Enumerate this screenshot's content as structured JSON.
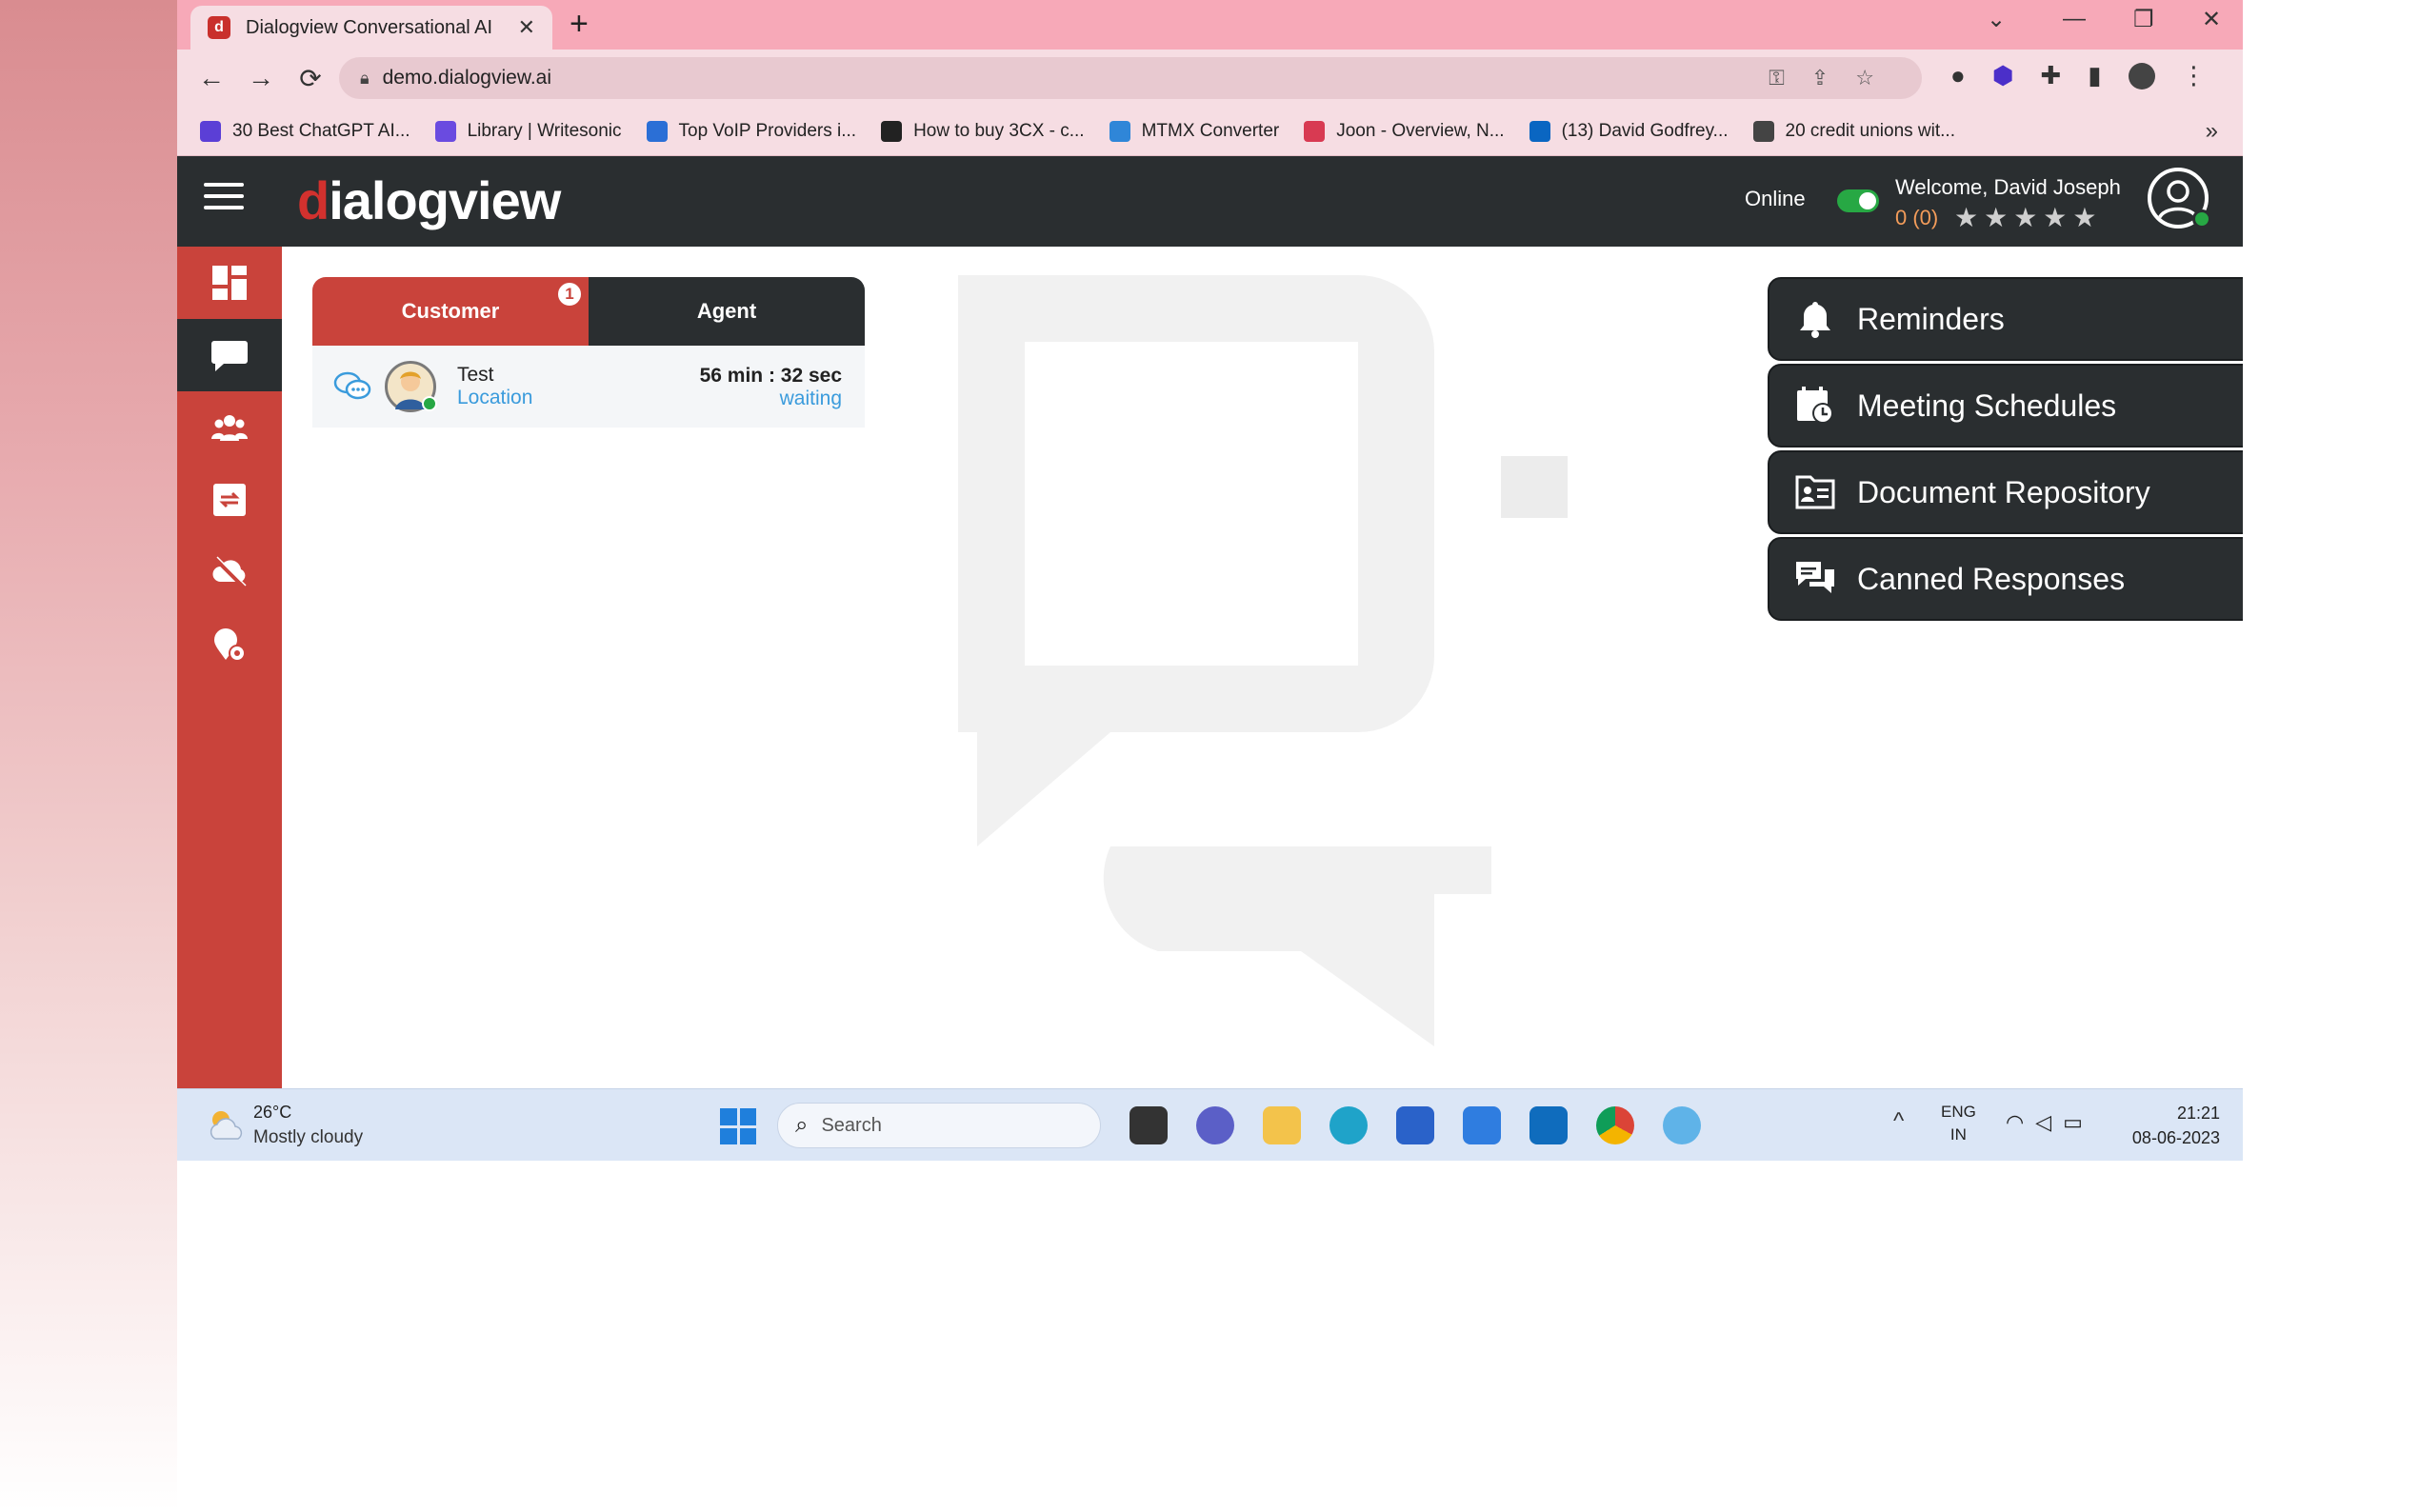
{
  "browser": {
    "tab_title": "Dialogview Conversational AI",
    "tab_favicon": "d",
    "new_tab": "+",
    "url": "demo.dialogview.ai",
    "bookmarks": [
      {
        "label": "30 Best ChatGPT AI...",
        "color": "#5b3fd6"
      },
      {
        "label": "Library | Writesonic",
        "color": "#6a4be0"
      },
      {
        "label": "Top VoIP Providers i...",
        "color": "#2b6fd6"
      },
      {
        "label": "How to buy 3CX - c...",
        "color": "#222222"
      },
      {
        "label": "MTMX Converter",
        "color": "#2f86d8"
      },
      {
        "label": "Joon - Overview, N...",
        "color": "#d83a52"
      },
      {
        "label": "(13) David Godfrey...",
        "color": "#0a66c2"
      },
      {
        "label": "20 credit unions wit...",
        "color": "#444444"
      }
    ],
    "bookmarks_more": "»"
  },
  "header": {
    "logo_d": "d",
    "logo_rest": "ialogview",
    "online_label": "Online",
    "welcome": "Welcome, David Joseph",
    "rating": "0 (0)",
    "stars": "★★★★★"
  },
  "sidebar": {
    "items": [
      {
        "icon": "dashboard-icon",
        "active": false
      },
      {
        "icon": "chat-icon",
        "active": true
      },
      {
        "icon": "users-icon",
        "active": false
      },
      {
        "icon": "transfer-icon",
        "active": false
      },
      {
        "icon": "cloud-off-icon",
        "active": false
      },
      {
        "icon": "location-icon",
        "active": false
      }
    ]
  },
  "queue": {
    "tab_customer": "Customer",
    "tab_agent": "Agent",
    "customer_badge": "1",
    "row": {
      "name": "Test",
      "location": "Location",
      "time": "56 min : 32 sec",
      "status": "waiting"
    }
  },
  "panel": {
    "reminders": "Reminders",
    "meetings": "Meeting Schedules",
    "documents": "Document Repository",
    "canned": "Canned Responses",
    "chevron": ">"
  },
  "taskbar": {
    "temp": "26°C",
    "weather": "Mostly cloudy",
    "search": "Search",
    "lang_top": "ENG",
    "lang_bottom": "IN",
    "time": "21:21",
    "date": "08-06-2023"
  },
  "colors": {
    "brand_red": "#c9433b",
    "dark": "#2a2e30",
    "online_green": "#27a844",
    "link_blue": "#3a9bdc"
  }
}
